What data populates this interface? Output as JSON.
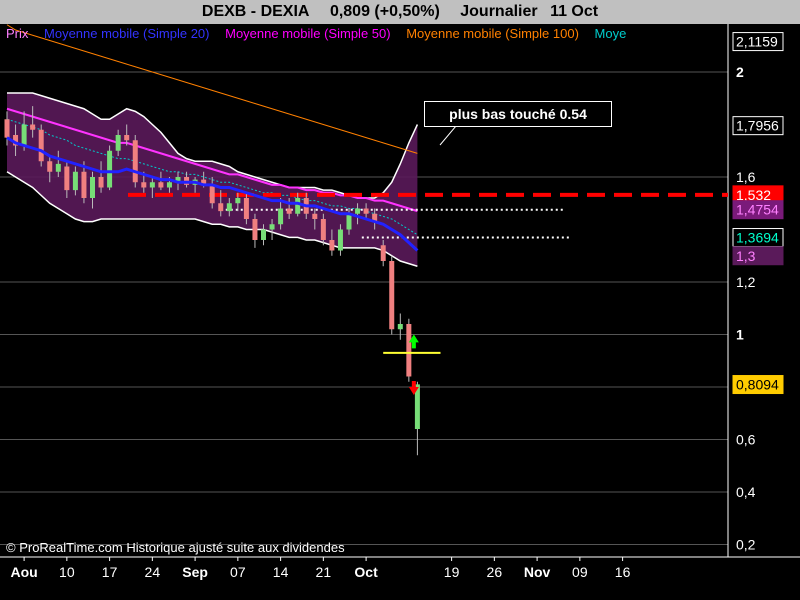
{
  "header": {
    "symbol": "DEXB - DEXIA",
    "quote": "0,809 (+0,50%)",
    "period": "Journalier",
    "date": "11 Oct"
  },
  "legend": [
    {
      "label": "Prix",
      "color": "#ff80ff"
    },
    {
      "label": "Moyenne mobile (Simple 20)",
      "color": "#3333ff"
    },
    {
      "label": "Moyenne mobile (Simple 50)",
      "color": "#ff00ff"
    },
    {
      "label": "Moyenne mobile (Simple 100)",
      "color": "#ff8000"
    },
    {
      "label": "Moye",
      "color": "#00cccc"
    }
  ],
  "copyright": "© ProRealTime.com Historique ajusté suite aux dividendes",
  "annotation": "plus bas touché 0.54",
  "chart_data": {
    "type": "candlestick",
    "ylim": [
      0.18,
      2.18
    ],
    "y_ticks": [
      "2",
      "1,6",
      "1,2",
      "1",
      "0,8",
      "0,6",
      "0,4",
      "0,2"
    ],
    "y_tick_values": [
      2.0,
      1.6,
      1.2,
      1.0,
      0.8,
      0.6,
      0.4,
      0.2
    ],
    "x_ticks": [
      "Aou",
      "10",
      "17",
      "24",
      "Sep",
      "07",
      "14",
      "21",
      "Oct",
      "19",
      "26",
      "Nov",
      "09",
      "16"
    ],
    "x_tick_values": [
      2,
      7,
      12,
      17,
      22,
      27,
      32,
      37,
      42,
      52,
      57,
      62,
      67,
      72
    ],
    "price_badges": [
      {
        "label": "2,1159",
        "value": 2.1159,
        "bg": "#000",
        "fg": "#fff",
        "border": "#fff"
      },
      {
        "label": "1,7956",
        "value": 1.7956,
        "bg": "#000",
        "fg": "#fff",
        "border": "#fff"
      },
      {
        "label": "1,532",
        "value": 1.532,
        "bg": "#ff0000",
        "fg": "#fff",
        "border": "#ff0000"
      },
      {
        "label": "1,4754",
        "value": 1.4754,
        "bg": "#7a1a7a",
        "fg": "#ff80ff",
        "border": "#7a1a7a"
      },
      {
        "label": "1,3694",
        "value": 1.3694,
        "bg": "#000",
        "fg": "#00ffcc",
        "border": "#fff"
      },
      {
        "label": "1,3",
        "value": 1.3,
        "bg": "#5a1a5a",
        "fg": "#ff80ff",
        "border": "#5a1a5a"
      },
      {
        "label": "0,8094",
        "value": 0.8094,
        "bg": "#ffcc00",
        "fg": "#000",
        "border": "#ffcc00"
      }
    ],
    "candles": [
      [
        1.82,
        1.85,
        1.72,
        1.75
      ],
      [
        1.76,
        1.8,
        1.68,
        1.72
      ],
      [
        1.72,
        1.85,
        1.7,
        1.8
      ],
      [
        1.8,
        1.87,
        1.75,
        1.78
      ],
      [
        1.78,
        1.8,
        1.64,
        1.66
      ],
      [
        1.66,
        1.68,
        1.58,
        1.62
      ],
      [
        1.62,
        1.7,
        1.6,
        1.65
      ],
      [
        1.64,
        1.66,
        1.52,
        1.55
      ],
      [
        1.55,
        1.64,
        1.53,
        1.62
      ],
      [
        1.62,
        1.66,
        1.5,
        1.52
      ],
      [
        1.52,
        1.62,
        1.48,
        1.6
      ],
      [
        1.6,
        1.66,
        1.54,
        1.56
      ],
      [
        1.56,
        1.72,
        1.55,
        1.7
      ],
      [
        1.7,
        1.78,
        1.68,
        1.76
      ],
      [
        1.76,
        1.8,
        1.72,
        1.74
      ],
      [
        1.74,
        1.76,
        1.56,
        1.58
      ],
      [
        1.58,
        1.62,
        1.54,
        1.56
      ],
      [
        1.56,
        1.6,
        1.52,
        1.58
      ],
      [
        1.58,
        1.62,
        1.55,
        1.56
      ],
      [
        1.56,
        1.6,
        1.54,
        1.58
      ],
      [
        1.58,
        1.62,
        1.55,
        1.6
      ],
      [
        1.6,
        1.62,
        1.56,
        1.57
      ],
      [
        1.57,
        1.6,
        1.54,
        1.59
      ],
      [
        1.59,
        1.62,
        1.56,
        1.57
      ],
      [
        1.57,
        1.6,
        1.48,
        1.5
      ],
      [
        1.5,
        1.55,
        1.45,
        1.47
      ],
      [
        1.47,
        1.52,
        1.45,
        1.5
      ],
      [
        1.5,
        1.54,
        1.47,
        1.52
      ],
      [
        1.52,
        1.54,
        1.42,
        1.44
      ],
      [
        1.44,
        1.46,
        1.33,
        1.36
      ],
      [
        1.36,
        1.42,
        1.34,
        1.4
      ],
      [
        1.4,
        1.44,
        1.36,
        1.42
      ],
      [
        1.42,
        1.52,
        1.4,
        1.48
      ],
      [
        1.48,
        1.52,
        1.44,
        1.46
      ],
      [
        1.46,
        1.54,
        1.45,
        1.52
      ],
      [
        1.52,
        1.54,
        1.44,
        1.46
      ],
      [
        1.46,
        1.48,
        1.4,
        1.44
      ],
      [
        1.44,
        1.46,
        1.34,
        1.36
      ],
      [
        1.36,
        1.4,
        1.3,
        1.32
      ],
      [
        1.32,
        1.42,
        1.3,
        1.4
      ],
      [
        1.4,
        1.48,
        1.38,
        1.46
      ],
      [
        1.46,
        1.5,
        1.42,
        1.48
      ],
      [
        1.48,
        1.5,
        1.44,
        1.46
      ],
      [
        1.46,
        1.48,
        1.4,
        1.43
      ],
      [
        1.34,
        1.36,
        1.26,
        1.28
      ],
      [
        1.28,
        1.3,
        1.0,
        1.02
      ],
      [
        1.02,
        1.08,
        0.98,
        1.04
      ],
      [
        1.04,
        1.06,
        0.82,
        0.84
      ],
      [
        0.64,
        0.82,
        0.54,
        0.81
      ]
    ],
    "ma20": [
      1.75,
      1.73,
      1.72,
      1.71,
      1.7,
      1.68,
      1.67,
      1.66,
      1.65,
      1.64,
      1.63,
      1.62,
      1.62,
      1.62,
      1.63,
      1.62,
      1.61,
      1.6,
      1.59,
      1.59,
      1.58,
      1.58,
      1.58,
      1.57,
      1.57,
      1.56,
      1.56,
      1.55,
      1.54,
      1.53,
      1.52,
      1.51,
      1.51,
      1.5,
      1.5,
      1.49,
      1.49,
      1.48,
      1.47,
      1.46,
      1.46,
      1.45,
      1.44,
      1.43,
      1.42,
      1.4,
      1.38,
      1.35,
      1.32
    ],
    "ma50": [
      1.86,
      1.85,
      1.84,
      1.83,
      1.82,
      1.81,
      1.8,
      1.79,
      1.78,
      1.77,
      1.76,
      1.75,
      1.74,
      1.73,
      1.73,
      1.72,
      1.71,
      1.7,
      1.69,
      1.68,
      1.67,
      1.66,
      1.65,
      1.64,
      1.63,
      1.62,
      1.61,
      1.61,
      1.6,
      1.59,
      1.58,
      1.57,
      1.57,
      1.56,
      1.56,
      1.55,
      1.55,
      1.54,
      1.54,
      1.53,
      1.53,
      1.52,
      1.52,
      1.51,
      1.51,
      1.5,
      1.49,
      1.48,
      1.47
    ],
    "ma100": [
      2.18,
      2.16,
      2.15,
      2.14,
      2.13,
      2.12,
      2.11,
      2.1,
      2.09,
      2.08,
      2.07,
      2.06,
      2.05,
      2.04,
      2.03,
      2.02,
      2.01,
      2.0,
      1.99,
      1.98,
      1.97,
      1.96,
      1.95,
      1.94,
      1.93,
      1.92,
      1.91,
      1.9,
      1.89,
      1.88,
      1.87,
      1.86,
      1.85,
      1.84,
      1.83,
      1.82,
      1.81,
      1.8,
      1.79,
      1.78,
      1.77,
      1.76,
      1.75,
      1.74,
      1.73,
      1.72,
      1.71,
      1.7,
      1.69
    ],
    "ma_cyan": [
      1.82,
      1.81,
      1.8,
      1.79,
      1.78,
      1.76,
      1.75,
      1.74,
      1.72,
      1.71,
      1.7,
      1.69,
      1.68,
      1.67,
      1.67,
      1.66,
      1.65,
      1.64,
      1.63,
      1.62,
      1.62,
      1.61,
      1.61,
      1.6,
      1.59,
      1.58,
      1.58,
      1.57,
      1.56,
      1.55,
      1.54,
      1.54,
      1.53,
      1.53,
      1.52,
      1.51,
      1.51,
      1.5,
      1.49,
      1.49,
      1.48,
      1.48,
      1.47,
      1.46,
      1.45,
      1.44,
      1.42,
      1.4,
      1.38
    ],
    "bb_upper": [
      1.92,
      1.92,
      1.92,
      1.92,
      1.91,
      1.9,
      1.89,
      1.88,
      1.87,
      1.86,
      1.84,
      1.82,
      1.82,
      1.84,
      1.86,
      1.85,
      1.83,
      1.8,
      1.77,
      1.73,
      1.69,
      1.67,
      1.66,
      1.66,
      1.66,
      1.65,
      1.64,
      1.62,
      1.61,
      1.6,
      1.59,
      1.58,
      1.57,
      1.56,
      1.56,
      1.56,
      1.56,
      1.55,
      1.55,
      1.54,
      1.53,
      1.52,
      1.52,
      1.52,
      1.54,
      1.58,
      1.65,
      1.73,
      1.8
    ],
    "bb_lower": [
      1.62,
      1.6,
      1.58,
      1.56,
      1.53,
      1.5,
      1.48,
      1.46,
      1.44,
      1.43,
      1.43,
      1.44,
      1.44,
      1.44,
      1.44,
      1.44,
      1.44,
      1.44,
      1.44,
      1.44,
      1.44,
      1.44,
      1.44,
      1.43,
      1.42,
      1.42,
      1.41,
      1.41,
      1.4,
      1.4,
      1.4,
      1.39,
      1.38,
      1.37,
      1.37,
      1.36,
      1.36,
      1.35,
      1.34,
      1.33,
      1.33,
      1.33,
      1.33,
      1.33,
      1.32,
      1.3,
      1.28,
      1.27,
      1.26
    ],
    "resistance_line": 1.532,
    "dotted_levels": [
      {
        "value": 1.4754,
        "start": 25,
        "end": 65
      },
      {
        "value": 1.3694,
        "start": 41.5,
        "end": 66
      }
    ],
    "target_line": {
      "value": 0.93,
      "start": 44,
      "end": 50
    },
    "arrows": [
      {
        "value": 0.97,
        "x": 47,
        "dir": "up",
        "color": "#00ff00"
      },
      {
        "value": 0.8,
        "x": 47,
        "dir": "down",
        "color": "#ff0000"
      }
    ]
  }
}
